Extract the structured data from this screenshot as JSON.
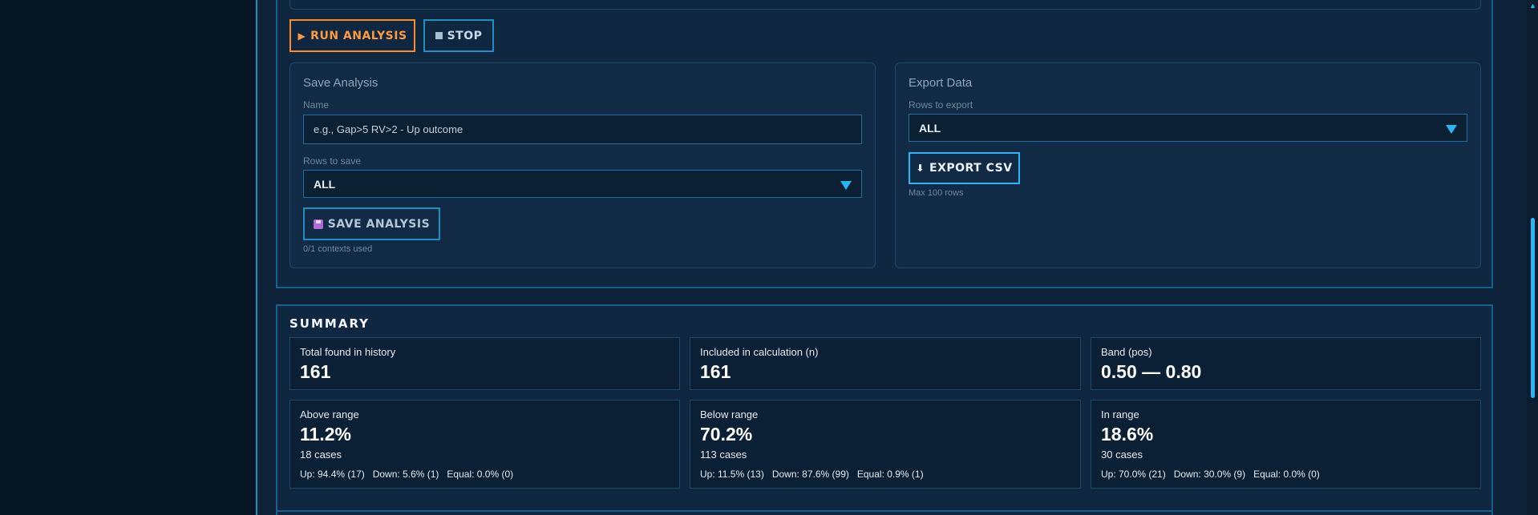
{
  "actions": {
    "run_label": "RUN ANALYSIS",
    "run_icon": "▶",
    "stop_label": "STOP"
  },
  "save": {
    "title": "Save Analysis",
    "name_label": "Name",
    "name_placeholder": "e.g., Gap>5 RV>2 - Up outcome",
    "rows_label": "Rows to save",
    "rows_value": "ALL",
    "button_label": "SAVE ANALYSIS",
    "contexts_used": "0/1 contexts used"
  },
  "export": {
    "title": "Export Data",
    "rows_label": "Rows to export",
    "rows_value": "ALL",
    "button_label": "EXPORT CSV",
    "button_icon": "⬇",
    "max_rows": "Max 100 rows"
  },
  "summary": {
    "title": "SUMMARY",
    "total_label": "Total found in history",
    "total_value": "161",
    "included_label": "Included in calculation (n)",
    "included_value": "161",
    "band_label": "Band (pos)",
    "band_value": "0.50 — 0.80",
    "above": {
      "label": "Above range",
      "pct": "11.2%",
      "cases": "18 cases",
      "up": "Up: 94.4% (17)",
      "down": "Down: 5.6% (1)",
      "equal": "Equal: 0.0% (0)"
    },
    "below": {
      "label": "Below range",
      "pct": "70.2%",
      "cases": "113 cases",
      "up": "Up: 11.5% (13)",
      "down": "Down: 87.6% (99)",
      "equal": "Equal: 0.9% (1)"
    },
    "inrange": {
      "label": "In range",
      "pct": "18.6%",
      "cases": "30 cases",
      "up": "Up: 70.0% (21)",
      "down": "Down: 30.0% (9)",
      "equal": "Equal: 0.0% (0)"
    }
  },
  "colors": {
    "accent": "#29b6f6",
    "run": "#ff8a2a",
    "panel": "#0f2740",
    "background": "#0a1a2b"
  }
}
